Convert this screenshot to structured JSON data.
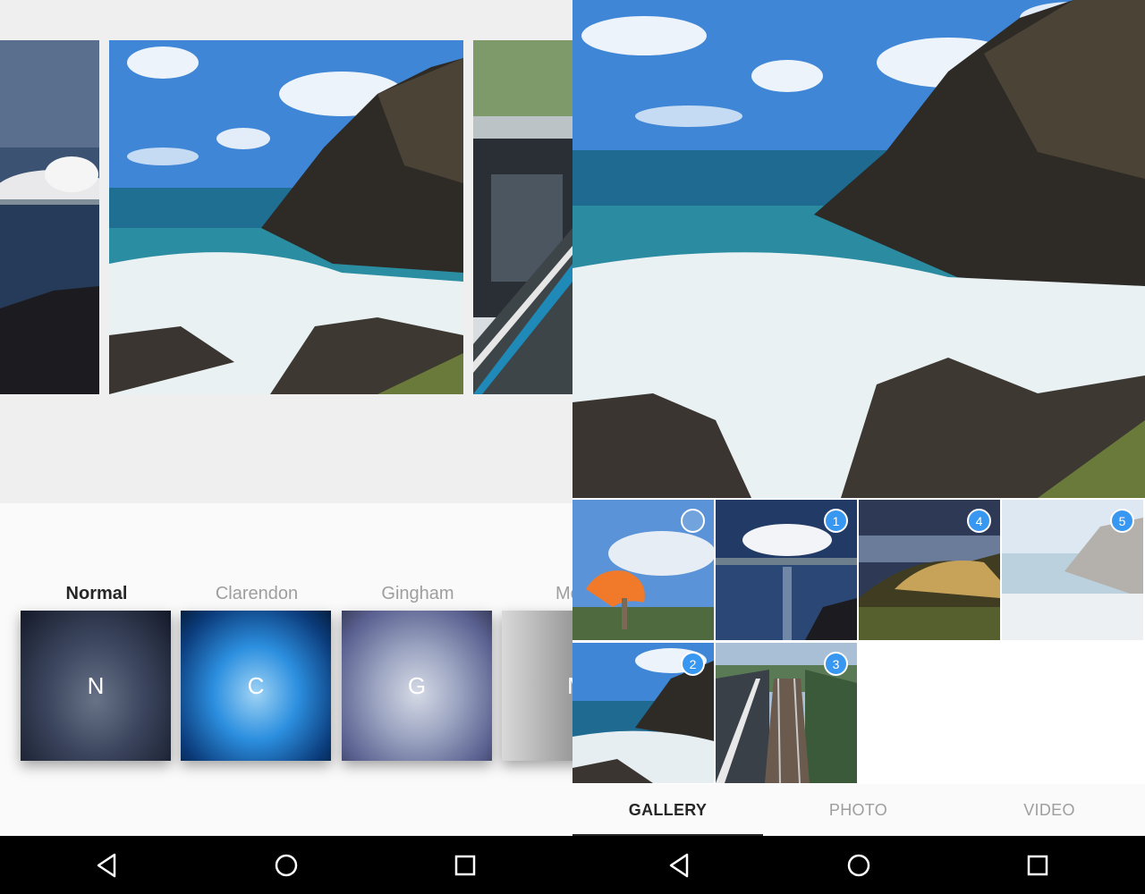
{
  "editor": {
    "filters": [
      {
        "name": "Normal",
        "letter": "N",
        "active": true
      },
      {
        "name": "Clarendon",
        "letter": "C",
        "active": false
      },
      {
        "name": "Gingham",
        "letter": "G",
        "active": false
      },
      {
        "name": "Moon",
        "letter": "M",
        "active": false
      }
    ]
  },
  "gallery": {
    "tiles": [
      {
        "subject": "giant-prawn",
        "badge": "",
        "selected": false
      },
      {
        "subject": "sunset-sea",
        "badge": "1",
        "selected": true
      },
      {
        "subject": "headland-sunset",
        "badge": "4",
        "selected": true
      },
      {
        "subject": "faded-coast",
        "badge": "5",
        "selected": true
      },
      {
        "subject": "rocky-coast",
        "badge": "2",
        "selected": true
      },
      {
        "subject": "train-station",
        "badge": "3",
        "selected": true
      }
    ],
    "tabs": [
      {
        "label": "GALLERY",
        "active": true
      },
      {
        "label": "PHOTO",
        "active": false
      },
      {
        "label": "VIDEO",
        "active": false
      }
    ]
  },
  "navbar": {
    "icons": [
      "back-icon",
      "home-icon",
      "recents-icon"
    ]
  },
  "colors": {
    "selection_badge": "#3897f0",
    "active_text": "#262626",
    "inactive_text": "#9e9e9e",
    "navbar": "#000000"
  }
}
